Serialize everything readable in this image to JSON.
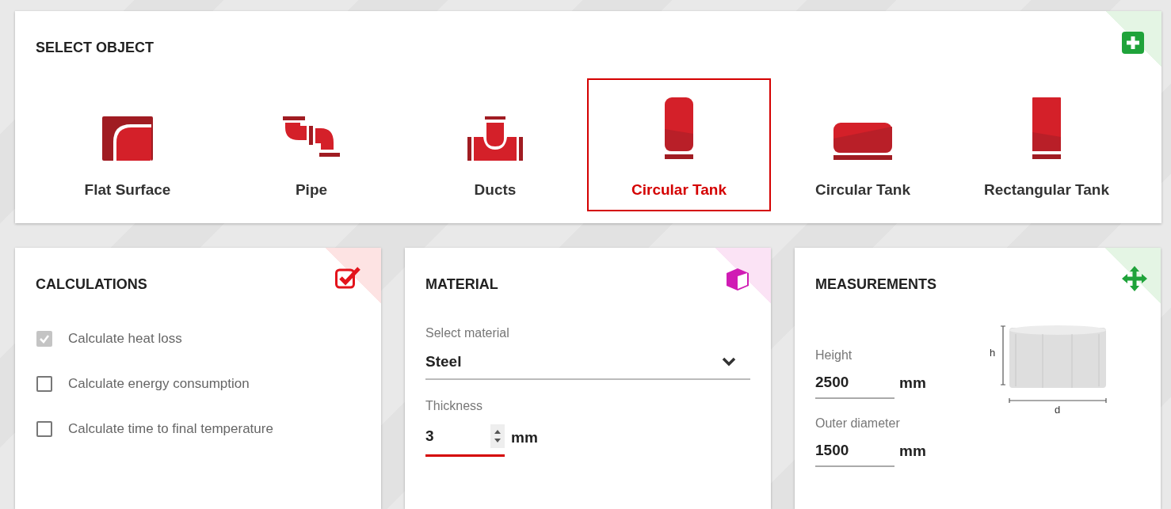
{
  "select_object": {
    "title": "SELECT OBJECT",
    "objects": [
      {
        "label": "Flat Surface",
        "kind": "flat",
        "selected": false
      },
      {
        "label": "Pipe",
        "kind": "pipe",
        "selected": false
      },
      {
        "label": "Ducts",
        "kind": "duct",
        "selected": false
      },
      {
        "label": "Circular Tank",
        "kind": "vertical_tank",
        "selected": true
      },
      {
        "label": "Circular Tank",
        "kind": "horizontal_tank",
        "selected": false
      },
      {
        "label": "Rectangular Tank",
        "kind": "rect_tank",
        "selected": false
      }
    ]
  },
  "calculations": {
    "title": "CALCULATIONS",
    "options": [
      {
        "label": "Calculate heat loss",
        "checked": true,
        "disabled": true
      },
      {
        "label": "Calculate energy consumption",
        "checked": false,
        "disabled": false
      },
      {
        "label": "Calculate time to final temperature",
        "checked": false,
        "disabled": false
      }
    ]
  },
  "material": {
    "title": "MATERIAL",
    "select": {
      "label": "Select material",
      "value": "Steel"
    },
    "thickness": {
      "label": "Thickness",
      "value": "3",
      "unit": "mm",
      "focused": true
    }
  },
  "measurements": {
    "title": "MEASUREMENTS",
    "fields": [
      {
        "label": "Height",
        "value": "2500",
        "unit": "mm"
      },
      {
        "label": "Outer diameter",
        "value": "1500",
        "unit": "mm"
      }
    ],
    "diagram": {
      "height_label": "h",
      "diameter_label": "d"
    }
  }
}
